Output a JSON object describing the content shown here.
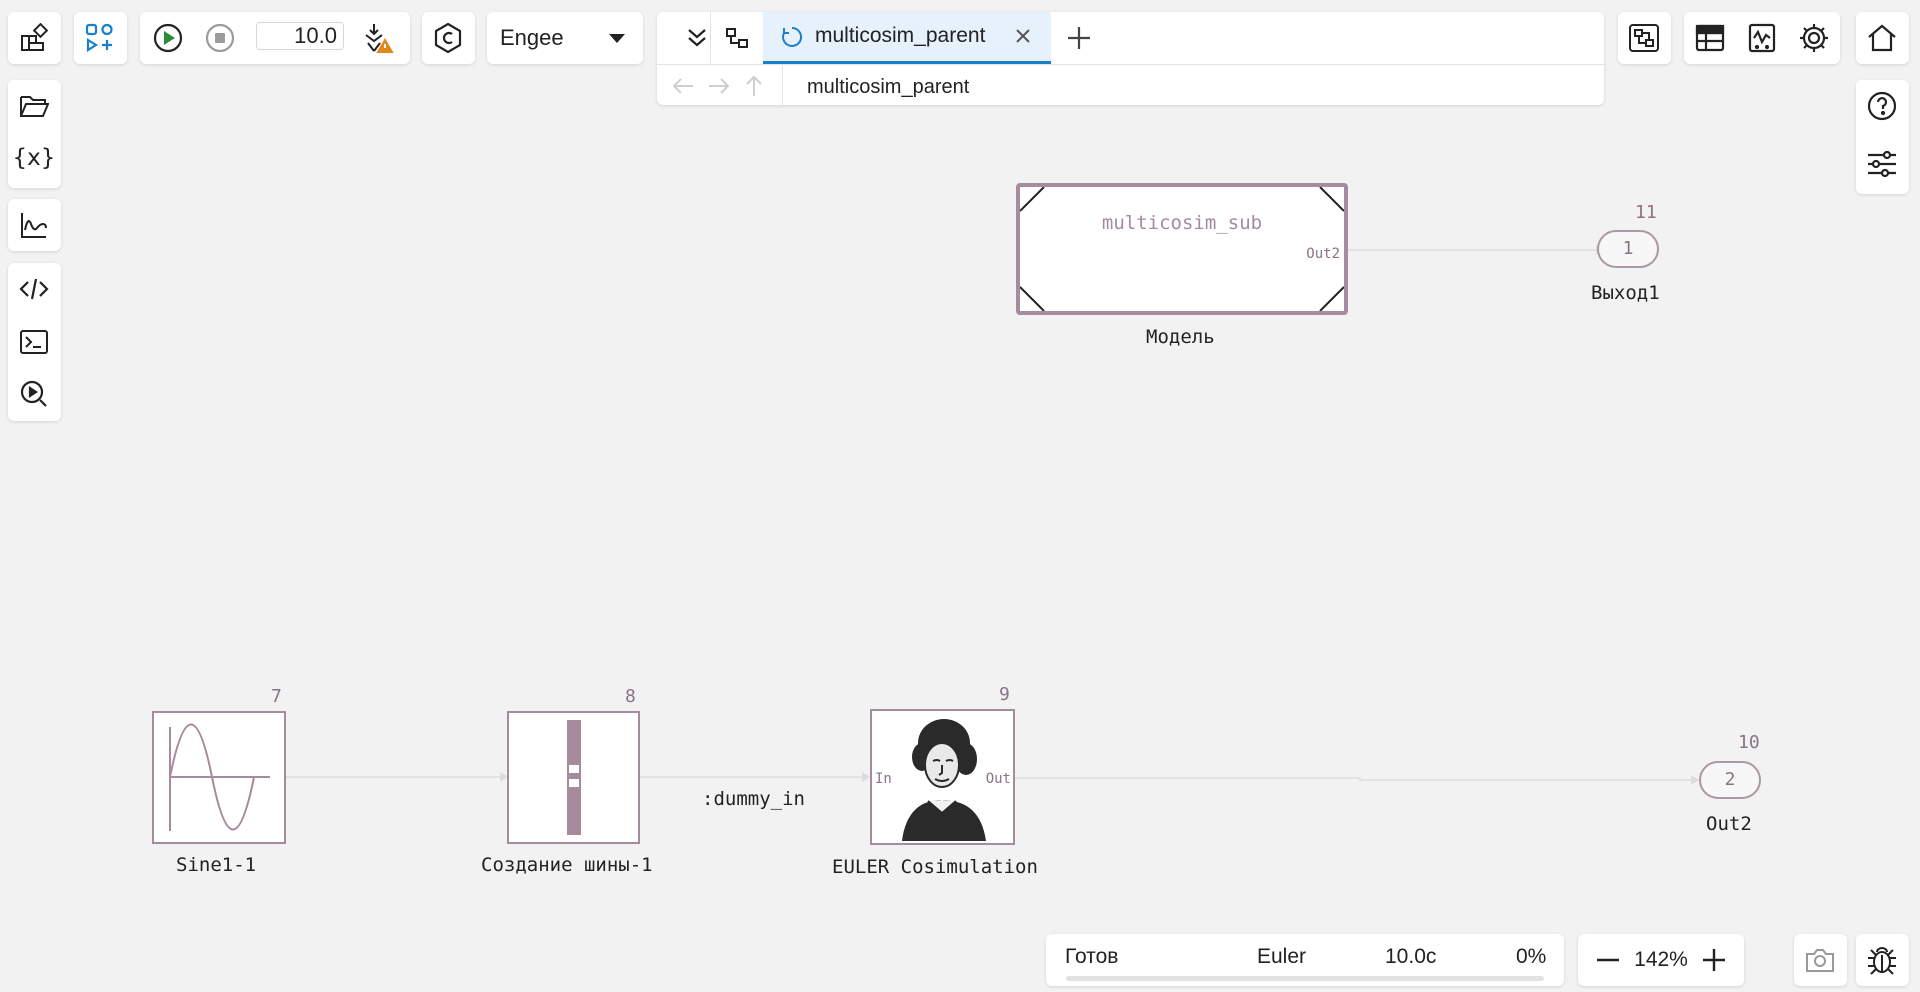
{
  "toolbar": {
    "sim_time": "10.0",
    "engine": "Engee"
  },
  "tabs": [
    {
      "title": "multicosim_parent",
      "active": true
    }
  ],
  "breadcrumb": "multicosim_parent",
  "diagram": {
    "blocks": {
      "model": {
        "inner_label": "multicosim_sub",
        "port_out": "Out2",
        "label": "Модель"
      },
      "out1": {
        "number": "11",
        "port_value": "1",
        "label": "Выход1"
      },
      "sine": {
        "number": "7",
        "label": "Sine1-1"
      },
      "bus": {
        "number": "8",
        "label": "Создание шины-1"
      },
      "signal_label": ":dummy_in",
      "euler": {
        "number": "9",
        "port_in": "In",
        "port_out": "Out",
        "label": "EULER Cosimulation"
      },
      "out2": {
        "number": "10",
        "port_value": "2",
        "label": "Out2"
      }
    }
  },
  "status": {
    "state": "Готов",
    "solver": "Euler",
    "time": "10.0с",
    "progress": "0%",
    "progress_fraction": 0
  },
  "zoom": {
    "value": "142%"
  },
  "colors": {
    "accent": "#1a80c9",
    "block_border": "#a58b9d",
    "port_text": "#8a7384"
  }
}
